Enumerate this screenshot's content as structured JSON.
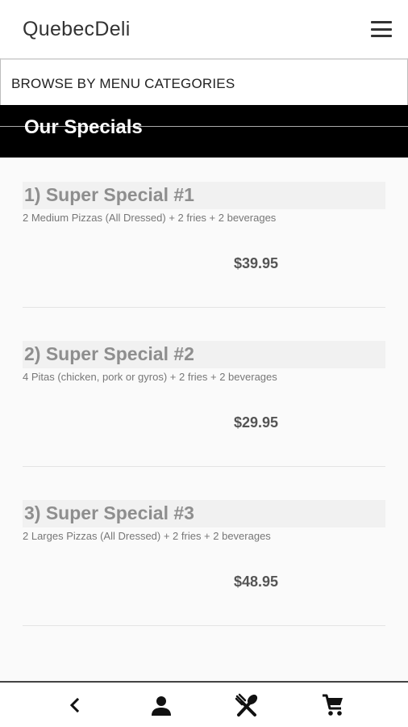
{
  "app": {
    "title": "QuebecDeli"
  },
  "header": {
    "menu_icon": "hamburger-menu-icon"
  },
  "category_select": {
    "label": "BROWSE BY MENU CATEGORIES",
    "icon": "dropdown-caret-icon"
  },
  "section": {
    "title": "Our Specials"
  },
  "specials": [
    {
      "name": "1)  Super Special #1",
      "description": "2 Medium Pizzas (All Dressed) + 2 fries + 2 beverages",
      "price": "$39.95"
    },
    {
      "name": "2)  Super Special #2",
      "description": "4 Pitas (chicken, pork or gyros) + 2 fries + 2 beverages",
      "price": "$29.95"
    },
    {
      "name": "3)  Super Special #3",
      "description": "2 Larges Pizzas (All Dressed) + 2 fries + 2 beverages",
      "price": "$48.95"
    }
  ],
  "bottom_nav": {
    "items": [
      {
        "icon": "back-chevron-icon"
      },
      {
        "icon": "person-icon"
      },
      {
        "icon": "utensils-icon"
      },
      {
        "icon": "shopping-cart-icon"
      }
    ]
  }
}
